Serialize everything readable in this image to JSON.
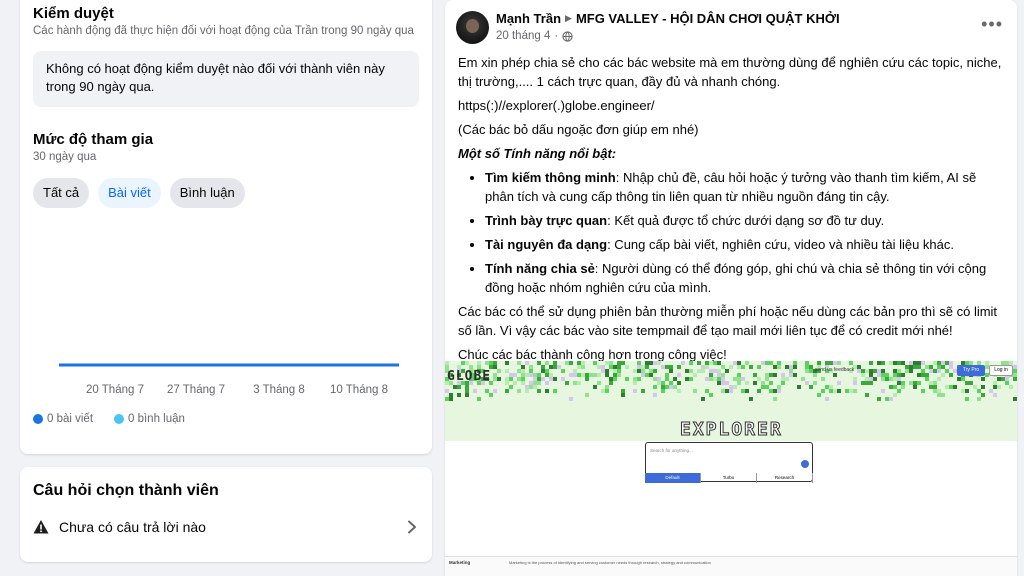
{
  "moderation": {
    "title": "Kiểm duyệt",
    "subtitle": "Các hành động đã thực hiện đối với hoạt động của Trần trong 90 ngày qua",
    "info": "Không có hoạt động kiểm duyệt nào đối với thành viên này trong 90 ngày qua."
  },
  "engagement": {
    "title": "Mức độ tham gia",
    "subtitle": "30 ngày qua",
    "chips": [
      {
        "label": "Tất cả",
        "active": false
      },
      {
        "label": "Bài viết",
        "active": true
      },
      {
        "label": "Bình luận",
        "active": false
      }
    ],
    "legend": {
      "posts": "0 bài viết",
      "comments": "0 bình luận"
    }
  },
  "chart_data": {
    "type": "line",
    "categories": [
      "20 Tháng 7",
      "27 Tháng 7",
      "3 Tháng 8",
      "10 Tháng 8"
    ],
    "series": [
      {
        "name": "0 bài viết",
        "values": [
          0,
          0,
          0,
          0
        ],
        "color": "#1b74e4"
      },
      {
        "name": "0 bình luận",
        "values": [
          0,
          0,
          0,
          0
        ],
        "color": "#4cc3f0"
      }
    ],
    "title": "",
    "xlabel": "",
    "ylabel": "",
    "grid": false,
    "legend": "bottom-left"
  },
  "questions": {
    "title": "Câu hỏi chọn thành viên",
    "empty": "Chưa có câu trả lời nào"
  },
  "post": {
    "author": "Mạnh Trần",
    "group": "MFG VALLEY - HỘI DÂN CHƠI QUẬT KHỞI",
    "date": "20 tháng 4",
    "more": "•••",
    "p1": "Em xin phép chia sẻ cho các bác website mà em thường dùng để nghiên cứu các topic, niche, thị trường,.... 1 cách trực quan, đầy đủ và nhanh chóng.",
    "link": "https(:)//explorer(.)globe.engineer/",
    "note": "(Các bác bỏ dấu ngoặc đơn giúp em nhé)",
    "features_heading": "Một số Tính năng nổi bật:",
    "features": [
      {
        "name": "Tìm kiếm thông minh",
        "desc": ": Nhập chủ đề, câu hỏi hoặc ý tưởng vào thanh tìm kiếm, AI sẽ phân tích và cung cấp thông tin liên quan từ nhiều nguồn đáng tin cậy."
      },
      {
        "name": "Trình bày trực quan",
        "desc": ": Kết quả được tổ chức dưới dạng sơ đồ tư duy."
      },
      {
        "name": "Tài nguyên đa dạng",
        "desc": ": Cung cấp bài viết, nghiên cứu, video và nhiều tài liệu khác."
      },
      {
        "name": "Tính năng chia sẻ",
        "desc": ": Người dùng có thể đóng góp, ghi chú và chia sẻ thông tin với cộng đồng hoặc nhóm nghiên cứu của mình."
      }
    ],
    "p2": "Các bác có thể sử dụng phiên bản thường miễn phí hoặc nếu dùng các bản pro thì sẽ có limit số lần. Vì vậy các bác vào site tempmail để tạo mail mới liên tục để có credit mới nhé!",
    "p3": "Chúc các bác thành công hơn trong công việc!"
  },
  "screenshot": {
    "logo": "GLOBE",
    "nav": "send us feedback",
    "try_pro": "Try Pro",
    "login": "Log in",
    "heading": "EXPLORER",
    "placeholder": "Search for anything...",
    "tabs": [
      "Default",
      "Turbo",
      "Research"
    ],
    "footer_a": "Marketing",
    "footer_b": "Marketing is the process of identifying and serving customer needs through research, strategy and communication"
  },
  "colors": {
    "accent": "#0866ff",
    "posts_dot": "#1b74e4",
    "comments_dot": "#4cc3f0"
  }
}
